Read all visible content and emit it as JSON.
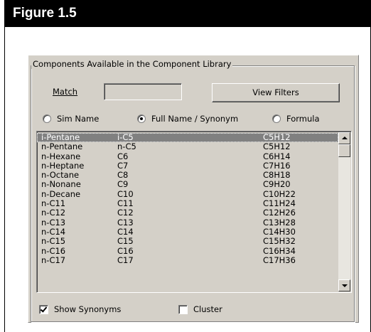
{
  "figure": {
    "title": "Figure 1.5"
  },
  "dialog": {
    "group_title": "Components Available in the Component Library",
    "match": {
      "label": "Match",
      "value": ""
    },
    "view_filters_label": "View Filters",
    "radios": [
      {
        "label": "Sim Name",
        "checked": false
      },
      {
        "label": "Full Name / Synonym",
        "checked": true
      },
      {
        "label": "Formula",
        "checked": false
      }
    ],
    "components": [
      {
        "name": "i-Pentane",
        "synonym": "i-C5",
        "formula": "C5H12",
        "selected": true
      },
      {
        "name": "n-Pentane",
        "synonym": "n-C5",
        "formula": "C5H12"
      },
      {
        "name": "n-Hexane",
        "synonym": "C6",
        "formula": "C6H14"
      },
      {
        "name": "n-Heptane",
        "synonym": "C7",
        "formula": "C7H16"
      },
      {
        "name": "n-Octane",
        "synonym": "C8",
        "formula": "C8H18"
      },
      {
        "name": "n-Nonane",
        "synonym": "C9",
        "formula": "C9H20"
      },
      {
        "name": "n-Decane",
        "synonym": "C10",
        "formula": "C10H22"
      },
      {
        "name": "n-C11",
        "synonym": "C11",
        "formula": "C11H24"
      },
      {
        "name": "n-C12",
        "synonym": "C12",
        "formula": "C12H26"
      },
      {
        "name": "n-C13",
        "synonym": "C13",
        "formula": "C13H28"
      },
      {
        "name": "n-C14",
        "synonym": "C14",
        "formula": "C14H30"
      },
      {
        "name": "n-C15",
        "synonym": "C15",
        "formula": "C15H32"
      },
      {
        "name": "n-C16",
        "synonym": "C16",
        "formula": "C16H34"
      },
      {
        "name": "n-C17",
        "synonym": "C17",
        "formula": "C17H36"
      }
    ],
    "show_synonyms": {
      "label": "Show Synonyms",
      "checked": true
    },
    "cluster": {
      "label": "Cluster",
      "checked": false
    }
  }
}
